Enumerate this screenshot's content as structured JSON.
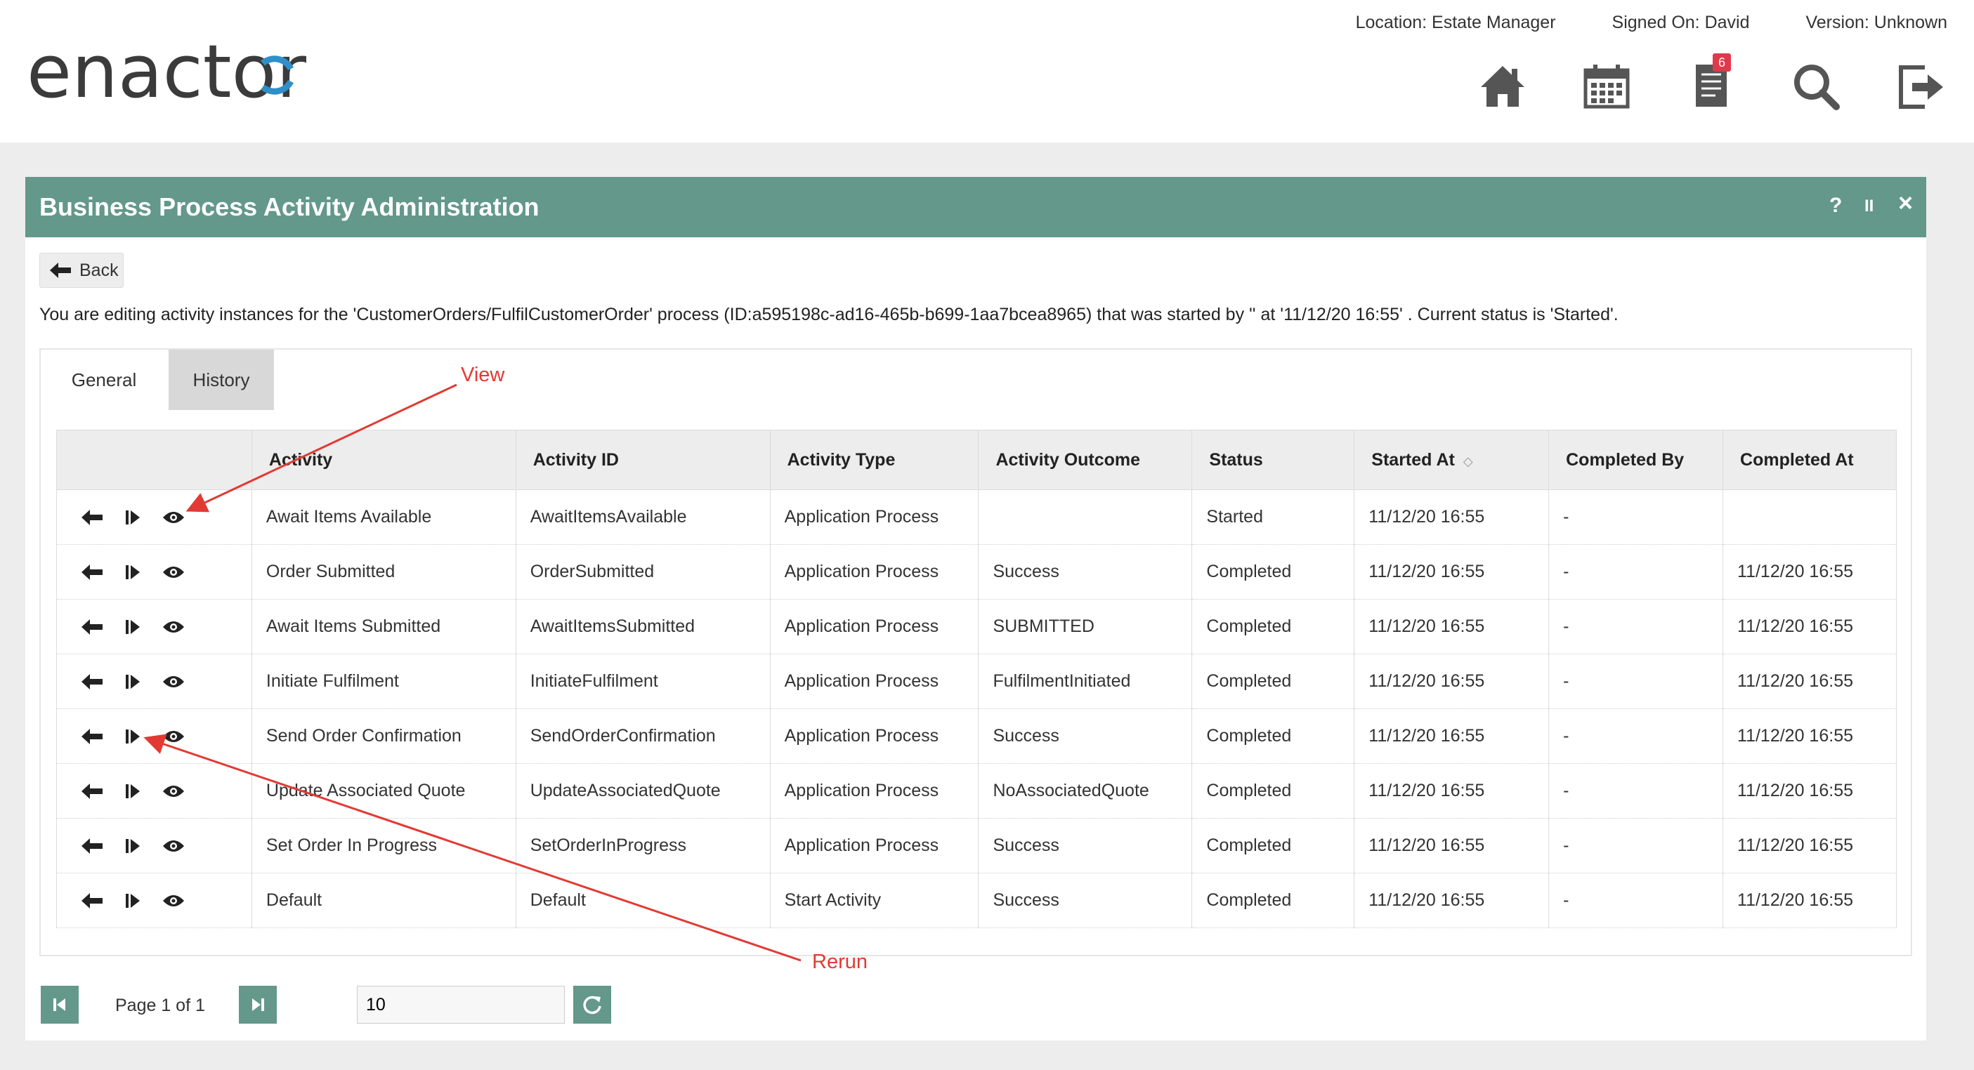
{
  "header": {
    "logo_text": "enactor",
    "location": "Location: Estate Manager",
    "signed_on": "Signed On: David",
    "version": "Version: Unknown",
    "icons": [
      "home-icon",
      "calendar-icon",
      "document-icon",
      "search-icon",
      "logout-icon"
    ],
    "notification_count": "6"
  },
  "panel": {
    "title": "Business Process Activity Administration",
    "help": "?",
    "pause": "II",
    "close": "×",
    "back_label": "Back",
    "editing_text": "You are editing activity instances for the 'CustomerOrders/FulfilCustomerOrder' process (ID:a595198c-ad16-465b-b699-1aa7bcea8965) that was started by '' at '11/12/20 16:55' . Current status is 'Started'."
  },
  "tabs": [
    {
      "label": "General",
      "active": true
    },
    {
      "label": "History",
      "active": false
    }
  ],
  "table": {
    "columns": [
      "",
      "Activity",
      "Activity ID",
      "Activity Type",
      "Activity Outcome",
      "Status",
      "Started At",
      "Completed By",
      "Completed At"
    ],
    "rows": [
      {
        "activity": "Await Items Available",
        "activity_id": "AwaitItemsAvailable",
        "type": "Application Process",
        "outcome": "",
        "status": "Started",
        "started_at": "11/12/20 16:55",
        "completed_by": "-",
        "completed_at": ""
      },
      {
        "activity": "Order Submitted",
        "activity_id": "OrderSubmitted",
        "type": "Application Process",
        "outcome": "Success",
        "status": "Completed",
        "started_at": "11/12/20 16:55",
        "completed_by": "-",
        "completed_at": "11/12/20 16:55"
      },
      {
        "activity": "Await Items Submitted",
        "activity_id": "AwaitItemsSubmitted",
        "type": "Application Process",
        "outcome": "SUBMITTED",
        "status": "Completed",
        "started_at": "11/12/20 16:55",
        "completed_by": "-",
        "completed_at": "11/12/20 16:55"
      },
      {
        "activity": "Initiate Fulfilment",
        "activity_id": "InitiateFulfilment",
        "type": "Application Process",
        "outcome": "FulfilmentInitiated",
        "status": "Completed",
        "started_at": "11/12/20 16:55",
        "completed_by": "-",
        "completed_at": "11/12/20 16:55"
      },
      {
        "activity": "Send Order Confirmation",
        "activity_id": "SendOrderConfirmation",
        "type": "Application Process",
        "outcome": "Success",
        "status": "Completed",
        "started_at": "11/12/20 16:55",
        "completed_by": "-",
        "completed_at": "11/12/20 16:55"
      },
      {
        "activity": "Update Associated Quote",
        "activity_id": "UpdateAssociatedQuote",
        "type": "Application Process",
        "outcome": "NoAssociatedQuote",
        "status": "Completed",
        "started_at": "11/12/20 16:55",
        "completed_by": "-",
        "completed_at": "11/12/20 16:55"
      },
      {
        "activity": "Set Order In Progress",
        "activity_id": "SetOrderInProgress",
        "type": "Application Process",
        "outcome": "Success",
        "status": "Completed",
        "started_at": "11/12/20 16:55",
        "completed_by": "-",
        "completed_at": "11/12/20 16:55"
      },
      {
        "activity": "Default",
        "activity_id": "Default",
        "type": "Start Activity",
        "outcome": "Success",
        "status": "Completed",
        "started_at": "11/12/20 16:55",
        "completed_by": "-",
        "completed_at": "11/12/20 16:55"
      }
    ]
  },
  "annotations": {
    "view": "View",
    "rerun": "Rerun",
    "color": "#e23a33"
  },
  "pagination": {
    "page_text": "Page 1 of 1",
    "page_size": "10"
  },
  "colors": {
    "accent": "#63988a",
    "logo_arrow": "#2f8fc9"
  }
}
